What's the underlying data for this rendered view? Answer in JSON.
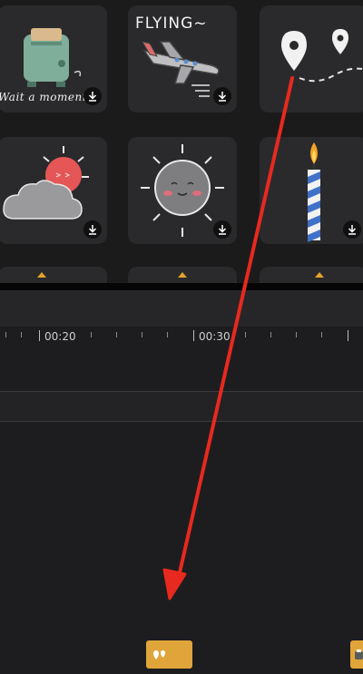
{
  "stickers": {
    "row1": [
      {
        "name": "toaster",
        "caption": "Wait a moment"
      },
      {
        "name": "airplane",
        "caption": "FLYING~"
      },
      {
        "name": "map-pins",
        "caption": ""
      }
    ],
    "row2": [
      {
        "name": "sun-cloud"
      },
      {
        "name": "smiling-sun"
      },
      {
        "name": "candle"
      }
    ]
  },
  "timeline": {
    "ticks": [
      "00:20",
      "00:30"
    ]
  },
  "colors": {
    "clip": "#e0a53a",
    "arrow": "#e8291f"
  }
}
